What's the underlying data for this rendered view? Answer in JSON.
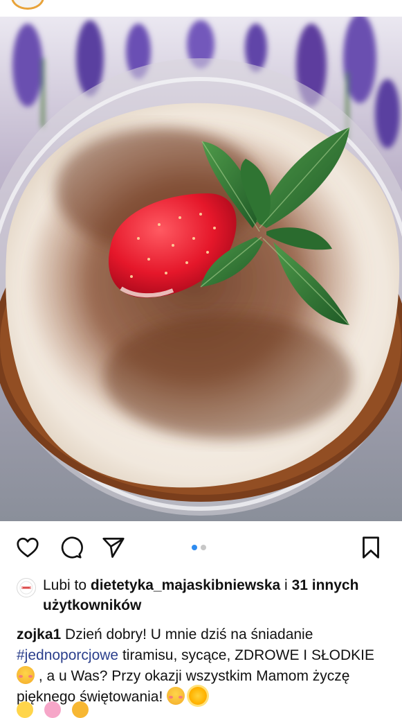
{
  "post": {
    "image_alt": "Tiramisu w szklanej miseczce z truskawką i miętą",
    "carousel": {
      "total": 2,
      "active_index": 0
    }
  },
  "actions": {
    "like_icon": "heart-icon",
    "comment_icon": "comment-bubble-icon",
    "share_icon": "paper-plane-icon",
    "save_icon": "bookmark-icon"
  },
  "likes": {
    "prefix": "Lubi to ",
    "user": "dietetyka_majaskibniewska",
    "connector": " i ",
    "others": "31 innych użytkowników"
  },
  "caption": {
    "author": "zojka1",
    "text_1": " Dzień dobry! U mnie dziś na śniadanie ",
    "hashtag": "#jednoporcjowe",
    "text_2": " tiramisu, sycące, ZDROWE I SŁODKIE ",
    "text_3": " , a u Was? Przy okazji wszystkim Mamom  życzę pięknego świętowania! "
  },
  "colors": {
    "accent_link": "#2b3f8c",
    "carousel_active": "#2f8cf0",
    "carousel_inactive": "#c7c7c7"
  }
}
